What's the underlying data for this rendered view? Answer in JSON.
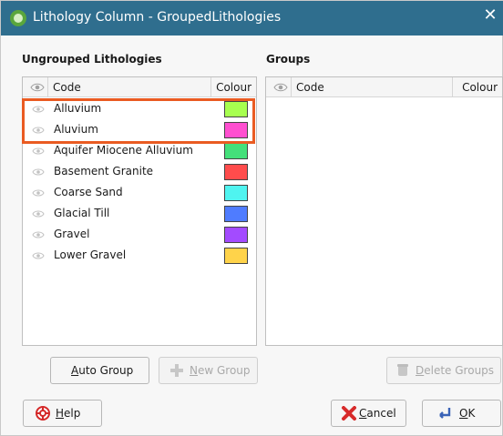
{
  "window": {
    "title": "Lithology Column - GroupedLithologies",
    "close_glyph": "✕"
  },
  "left_panel": {
    "title": "Ungrouped Lithologies",
    "header": {
      "code": "Code",
      "colour": "Colour"
    },
    "rows": [
      {
        "label": "Alluvium",
        "color": "#a7ff4f"
      },
      {
        "label": "Aluvium",
        "color": "#ff4fd0"
      },
      {
        "label": "Aquifer Miocene Alluvium",
        "color": "#44e07a"
      },
      {
        "label": "Basement Granite",
        "color": "#ff4c4c"
      },
      {
        "label": "Coarse Sand",
        "color": "#4ff4f0"
      },
      {
        "label": "Glacial Till",
        "color": "#4f7cff"
      },
      {
        "label": "Gravel",
        "color": "#a34bff"
      },
      {
        "label": "Lower Gravel",
        "color": "#ffd34a"
      }
    ]
  },
  "right_panel": {
    "title": "Groups",
    "header": {
      "code": "Code",
      "colour": "Colour"
    }
  },
  "buttons": {
    "auto_group": "Auto Group",
    "new_group": "New Group",
    "delete_groups": "Delete Groups",
    "help": "Help",
    "cancel": "Cancel",
    "ok": "OK"
  },
  "colors": {
    "title_bar": "#2f6e8e",
    "highlight": "#ea5b22"
  }
}
